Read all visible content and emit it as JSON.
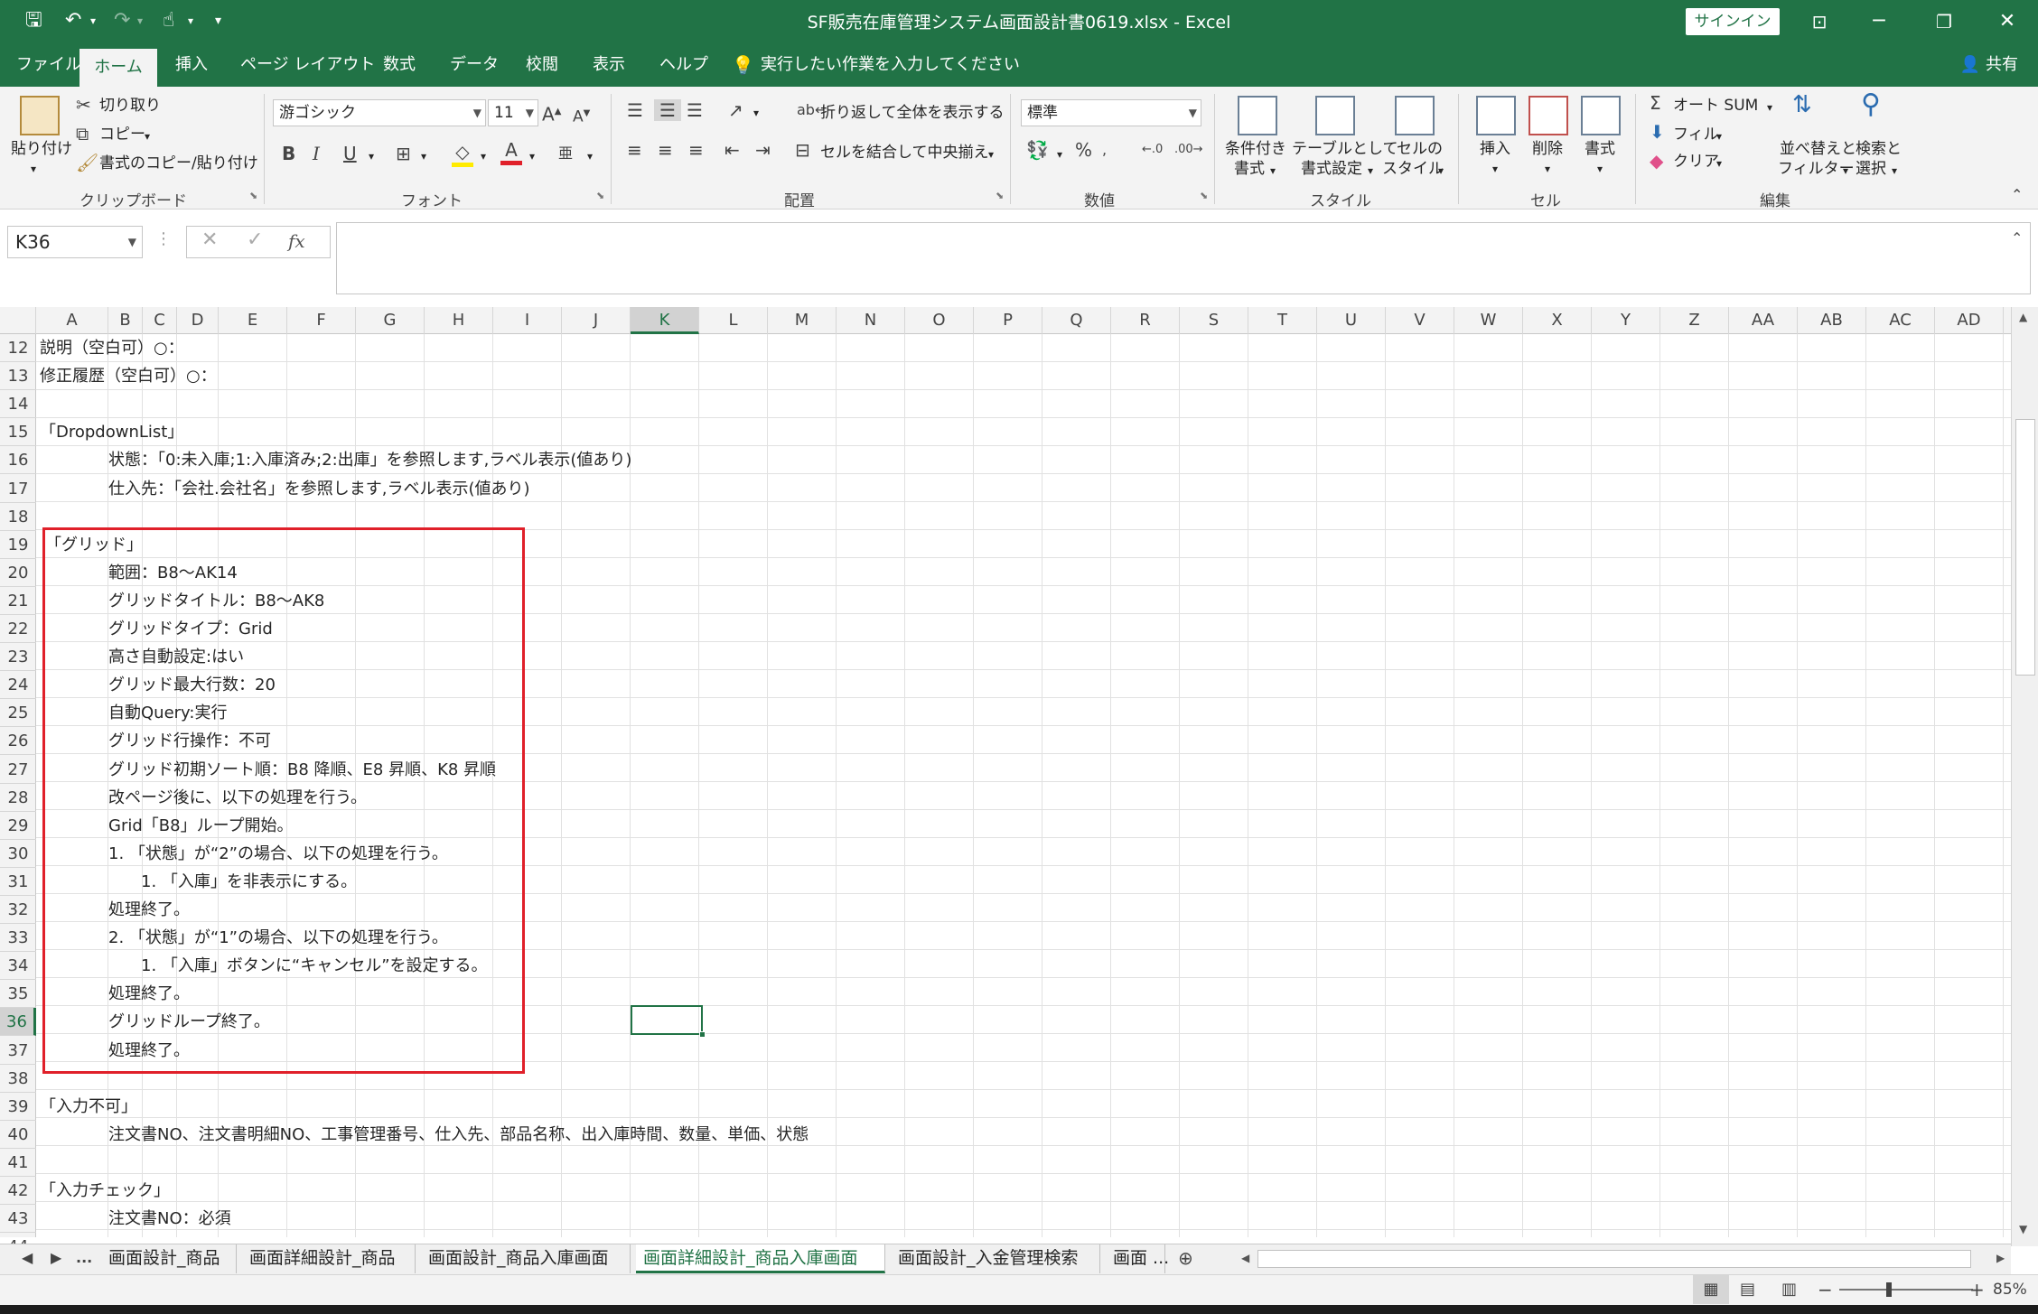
{
  "window": {
    "title": "SF販売在庫管理システム画面設計書0619.xlsx  -  Excel",
    "signin_label": "サインイン",
    "share_label": "共有"
  },
  "menu": {
    "tabs": [
      "ファイル",
      "ホーム",
      "挿入",
      "ページ レイアウト",
      "数式",
      "データ",
      "校閲",
      "表示",
      "ヘルプ"
    ],
    "tell_me": "実行したい作業を入力してください"
  },
  "ribbon": {
    "clipboard": {
      "group_label": "クリップボード",
      "paste": "貼り付け",
      "cut": "切り取り",
      "copy": "コピー",
      "format_painter": "書式のコピー/貼り付け"
    },
    "font": {
      "group_label": "フォント",
      "font_name": "游ゴシック",
      "font_size": "11",
      "bold": "B",
      "italic": "I",
      "underline": "U"
    },
    "alignment": {
      "group_label": "配置",
      "wrap_text": "折り返して全体を表示する",
      "merge_center": "セルを結合して中央揃え"
    },
    "number": {
      "group_label": "数値",
      "format": "標準",
      "percent": "%"
    },
    "styles": {
      "group_label": "スタイル",
      "conditional_line1": "条件付き",
      "conditional_line2": "書式",
      "table_line1": "テーブルとして",
      "table_line2": "書式設定",
      "cell_line1": "セルの",
      "cell_line2": "スタイル"
    },
    "cells": {
      "group_label": "セル",
      "insert": "挿入",
      "delete": "削除",
      "format": "書式"
    },
    "editing": {
      "group_label": "編集",
      "autosum": "オート SUM",
      "fill": "フィル",
      "clear": "クリア",
      "sort_line1": "並べ替えと",
      "sort_line2": "フィルター",
      "find_line1": "検索と",
      "find_line2": "選択"
    }
  },
  "formula_bar": {
    "name_box": "K36",
    "fx": "fx",
    "value": ""
  },
  "grid": {
    "columns": [
      "A",
      "B",
      "C",
      "D",
      "E",
      "F",
      "G",
      "H",
      "I",
      "J",
      "K",
      "L",
      "M",
      "N",
      "O",
      "P",
      "Q",
      "R",
      "S",
      "T",
      "U",
      "V",
      "W",
      "X",
      "Y",
      "Z",
      "AA",
      "AB",
      "AC",
      "AD"
    ],
    "selected_column": "K",
    "selected_row": "36",
    "rows": [
      {
        "num": "12",
        "col": "A",
        "text": "説明（空白可）○："
      },
      {
        "num": "13",
        "col": "A",
        "text": "修正履歴（空白可）○："
      },
      {
        "num": "14",
        "col": "A",
        "text": ""
      },
      {
        "num": "15",
        "col": "A",
        "text": "「DropdownList」"
      },
      {
        "num": "16",
        "col": "C",
        "text": "状態：「0:未入庫;1:入庫済み;2:出庫」を参照します,ラベル表示(値あり)"
      },
      {
        "num": "17",
        "col": "C",
        "text": "仕入先：「会社.会社名」を参照します,ラベル表示(値あり)"
      },
      {
        "num": "18",
        "col": "A",
        "text": ""
      },
      {
        "num": "19",
        "col": "A",
        "text": "「グリッド」"
      },
      {
        "num": "20",
        "col": "C",
        "text": "範囲：B8～AK14"
      },
      {
        "num": "21",
        "col": "C",
        "text": "グリッドタイトル：B8～AK8"
      },
      {
        "num": "22",
        "col": "C",
        "text": "グリッドタイプ：Grid"
      },
      {
        "num": "23",
        "col": "C",
        "text": "高さ自動設定:はい"
      },
      {
        "num": "24",
        "col": "C",
        "text": "グリッド最大行数：20"
      },
      {
        "num": "25",
        "col": "C",
        "text": "自動Query:実行"
      },
      {
        "num": "26",
        "col": "C",
        "text": "グリッド行操作：不可"
      },
      {
        "num": "27",
        "col": "C",
        "text": "グリッド初期ソート順：B8 降順、E8 昇順、K8 昇順"
      },
      {
        "num": "28",
        "col": "C",
        "text": "改ページ後に、以下の処理を行う。"
      },
      {
        "num": "29",
        "col": "C",
        "text": "Grid「B8」ループ開始。"
      },
      {
        "num": "30",
        "col": "C",
        "text": "1. 「状態」が“2”の場合、以下の処理を行う。"
      },
      {
        "num": "31",
        "col": "D",
        "text": "1. 「入庫」を非表示にする。"
      },
      {
        "num": "32",
        "col": "C",
        "text": "処理終了。"
      },
      {
        "num": "33",
        "col": "C",
        "text": "2. 「状態」が“1”の場合、以下の処理を行う。"
      },
      {
        "num": "34",
        "col": "D",
        "text": "1. 「入庫」ボタンに“キャンセル”を設定する。"
      },
      {
        "num": "35",
        "col": "C",
        "text": "処理終了。"
      },
      {
        "num": "36",
        "col": "C",
        "text": "グリッドループ終了。"
      },
      {
        "num": "37",
        "col": "C",
        "text": "処理終了。"
      },
      {
        "num": "38",
        "col": "A",
        "text": ""
      },
      {
        "num": "39",
        "col": "A",
        "text": "「入力不可」"
      },
      {
        "num": "40",
        "col": "C",
        "text": "注文書NO、注文書明細NO、工事管理番号、仕入先、部品名称、出入庫時間、数量、単価、状態"
      },
      {
        "num": "41",
        "col": "A",
        "text": ""
      },
      {
        "num": "42",
        "col": "A",
        "text": "「入力チェック」"
      },
      {
        "num": "43",
        "col": "C",
        "text": "注文書NO：必須"
      },
      {
        "num": "44",
        "col": "A",
        "text": ""
      }
    ]
  },
  "sheets": {
    "tabs": [
      "画面設計_商品",
      "画面詳細設計_商品",
      "画面設計_商品入庫画面",
      "画面詳細設計_商品入庫画面",
      "画面設計_入金管理検索",
      "画面 ..."
    ],
    "active_index": 3,
    "ellipsis": "..."
  },
  "status": {
    "zoom": "85%"
  },
  "colors": {
    "accent": "#217346",
    "highlight_box": "#e0202a"
  }
}
